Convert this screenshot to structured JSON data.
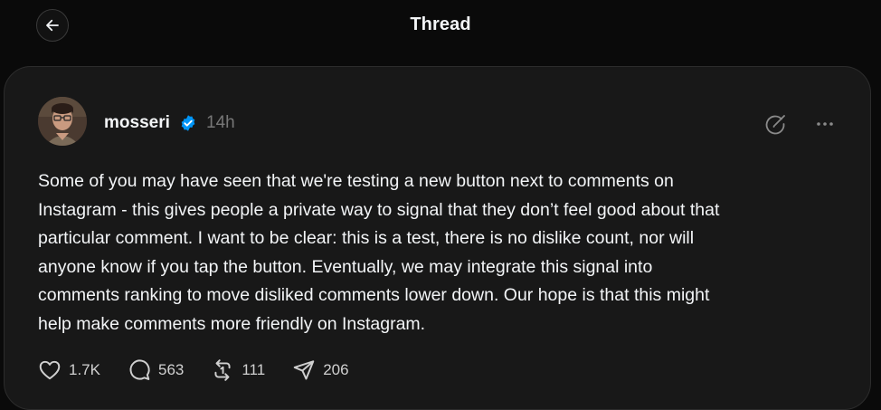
{
  "header": {
    "title": "Thread",
    "back_icon": "arrow-left-icon"
  },
  "post": {
    "username": "mosseri",
    "verified_icon": "verified-badge-icon",
    "verified_color": "#0095f6",
    "timestamp": "14h",
    "text": "Some of you may have seen that we're testing a new button next to comments on\nInstagram - this gives people a private way to signal that they don’t feel good about that\nparticular comment. I want to be clear: this is a test, there is no dislike count, nor will\nanyone know if you tap the button. Eventually, we may integrate this signal into\ncomments ranking to move disliked comments lower down. Our hope is that this might\nhelp make comments more friendly on Instagram.",
    "top_actions": [
      "edit-circle-icon",
      "more-options-icon"
    ],
    "stats": {
      "likes": "1.7K",
      "comments": "563",
      "reposts": "111",
      "shares": "206"
    }
  },
  "colors": {
    "background": "#0a0a0a",
    "card": "#181818",
    "text": "#f3f5f7",
    "muted": "#777777"
  }
}
